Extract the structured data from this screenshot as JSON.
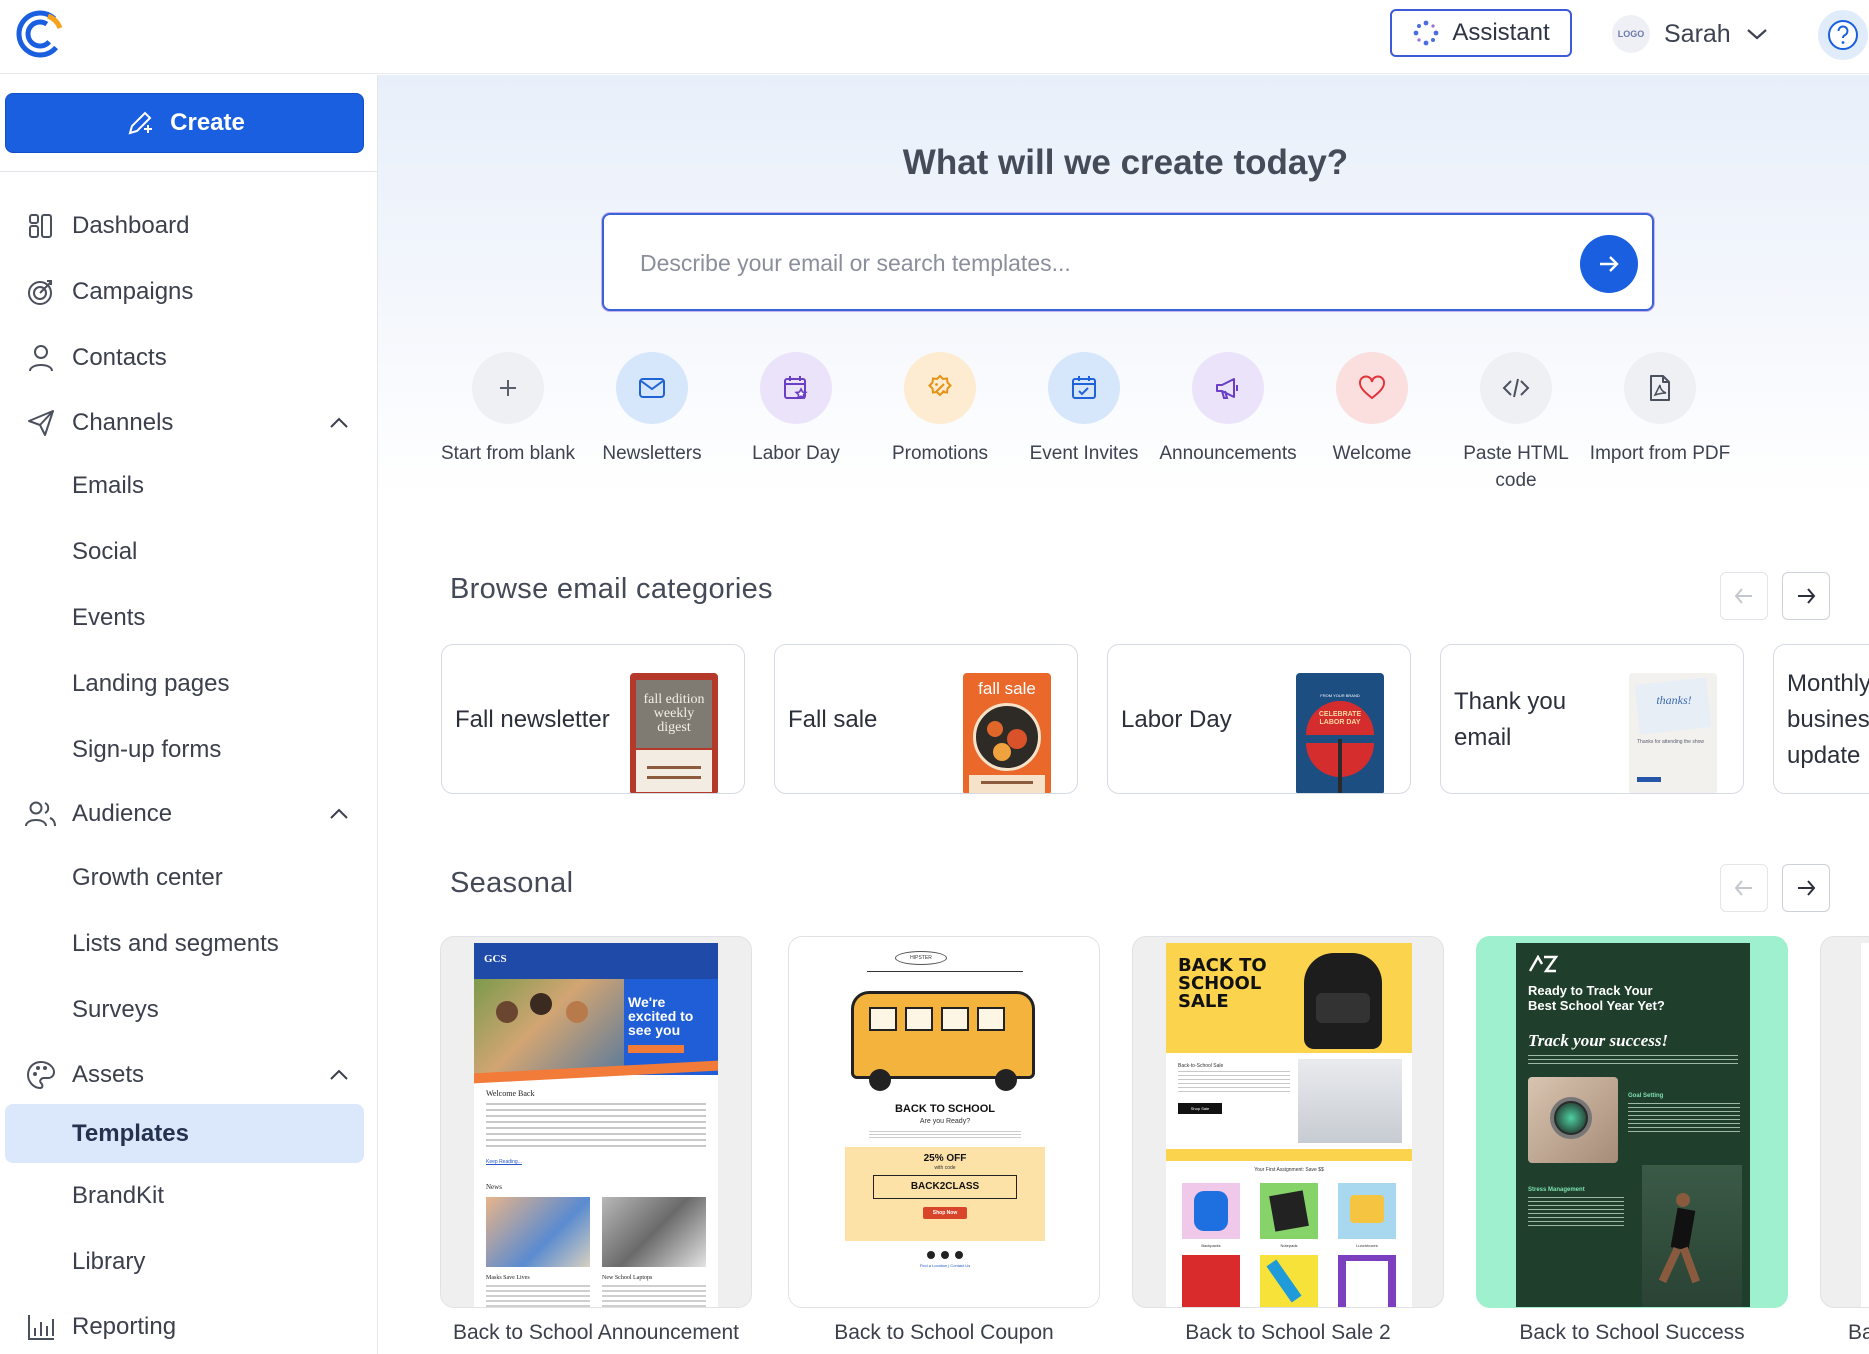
{
  "header": {
    "assistant_label": "Assistant",
    "user_name": "Sarah",
    "avatar_text": "LOGO"
  },
  "sidebar": {
    "create_label": "Create",
    "items": [
      {
        "label": "Dashboard"
      },
      {
        "label": "Campaigns"
      },
      {
        "label": "Contacts"
      },
      {
        "label": "Channels"
      },
      {
        "label": "Emails"
      },
      {
        "label": "Social"
      },
      {
        "label": "Events"
      },
      {
        "label": "Landing pages"
      },
      {
        "label": "Sign-up forms"
      },
      {
        "label": "Audience"
      },
      {
        "label": "Growth center"
      },
      {
        "label": "Lists and segments"
      },
      {
        "label": "Surveys"
      },
      {
        "label": "Assets"
      },
      {
        "label": "Templates"
      },
      {
        "label": "BrandKit"
      },
      {
        "label": "Library"
      },
      {
        "label": "Reporting"
      }
    ]
  },
  "hero": {
    "title": "What will we create today?",
    "search_placeholder": "Describe your email or search templates..."
  },
  "quick_actions": [
    {
      "label": "Start from blank",
      "icon": "plus-icon"
    },
    {
      "label": "Newsletters",
      "icon": "envelope-icon"
    },
    {
      "label": "Labor Day",
      "icon": "calendar-star-icon"
    },
    {
      "label": "Promotions",
      "icon": "percent-badge-icon"
    },
    {
      "label": "Event Invites",
      "icon": "calendar-check-icon"
    },
    {
      "label": "Announcements",
      "icon": "megaphone-icon"
    },
    {
      "label": "Welcome",
      "icon": "heart-icon"
    },
    {
      "label": "Paste HTML code",
      "icon": "code-icon"
    },
    {
      "label": "Import from PDF",
      "icon": "pdf-icon"
    }
  ],
  "categories": {
    "title": "Browse email categories",
    "items": [
      {
        "label": "Fall newsletter",
        "thumb_text": "fall edition weekly digest"
      },
      {
        "label": "Fall sale",
        "thumb_text": "fall sale"
      },
      {
        "label": "Labor Day",
        "thumb_text": "CELEBRATE LABOR DAY",
        "thumb_kicker": "FROM YOUR BRAND"
      },
      {
        "label": "Thank you email",
        "thumb_text": "thanks!",
        "thumb_caption": "Thanks for attending the show"
      },
      {
        "label": "Monthly business update"
      }
    ]
  },
  "seasonal": {
    "title": "Seasonal",
    "templates": [
      {
        "caption": "Back to School Announcement",
        "brand": "GCS",
        "headline": "We're excited to see you",
        "cta": "Visit School Website",
        "sub1": "Welcome Back",
        "sub2": "News",
        "news1": "Masks Save Lives",
        "news2": "New School Laptops",
        "link": "Keep Reading..."
      },
      {
        "caption": "Back to School Coupon",
        "brand": "HIPSTER",
        "headline": "BACK TO SCHOOL",
        "sub": "Are you Ready?",
        "offer": "25% OFF",
        "offer_sub": "with code",
        "code": "BACK2CLASS",
        "cta": "Shop Now",
        "footer": "Find a Location | Contact Us"
      },
      {
        "caption": "Back to School Sale 2",
        "headline": "BACK TO SCHOOL SALE",
        "sub": "Back-to-School Sale",
        "cta": "Shop Sale",
        "strip": "Your First Assignment: Save $$",
        "items": [
          "Backpacks",
          "Notepads",
          "Lunchboxes"
        ]
      },
      {
        "caption": "Back to School Success",
        "headline": "Ready to Track Your Best School Year Yet?",
        "script": "Track your success!",
        "sec1": "Goal Setting",
        "sec2": "Stress Management"
      },
      {
        "caption": "Ba"
      }
    ]
  },
  "colors": {
    "primary": "#1a5fe0",
    "active_nav": "#dbe7fb"
  }
}
